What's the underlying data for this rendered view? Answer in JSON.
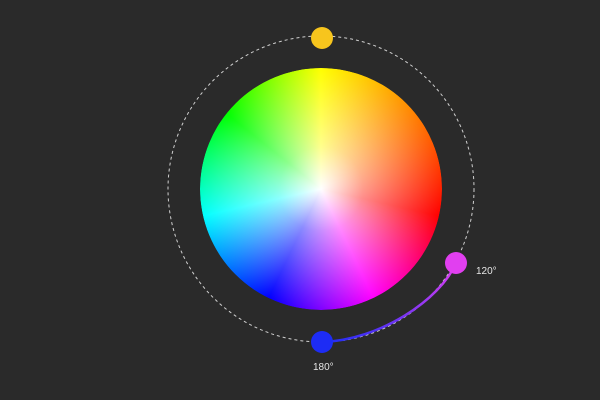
{
  "wheel": {
    "hues": [
      "#ff0000",
      "#ff8000",
      "#ffff00",
      "#00ff00",
      "#00ffff",
      "#0000ff",
      "#ff00ff",
      "#ff0000"
    ]
  },
  "orbit": {
    "stroke_color": "#d0d0d0"
  },
  "handles": [
    {
      "name": "handle-yellow",
      "color": "#f7c51d"
    },
    {
      "name": "handle-magenta",
      "color": "#e13ff0",
      "label": "120°"
    },
    {
      "name": "handle-blue",
      "color": "#1d2cf5",
      "label": "180°"
    }
  ],
  "arc": {
    "from_color": "#1d2cf5",
    "to_color": "#e13ff0"
  }
}
